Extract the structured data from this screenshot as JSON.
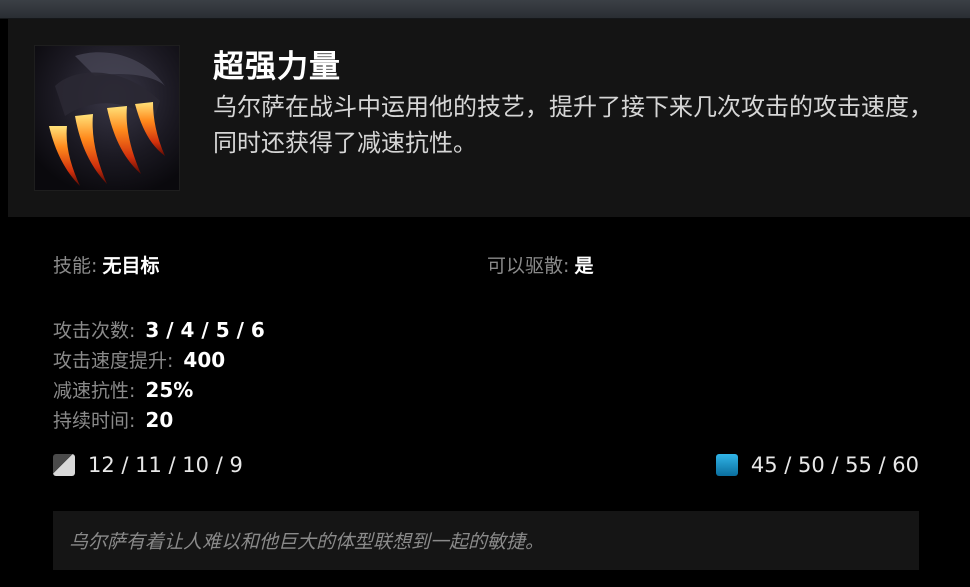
{
  "ability": {
    "icon": "claws-flame-icon",
    "title": "超强力量",
    "description": "乌尔萨在战斗中运用他的技艺，提升了接下来几次攻击的攻击速度，同时还获得了减速抗性。"
  },
  "info": {
    "ability_label": "技能:",
    "ability_value": "无目标",
    "dispellable_label": "可以驱散:",
    "dispellable_value": "是"
  },
  "stats": [
    {
      "label": "攻击次数:",
      "value": "3 / 4 / 5 / 6"
    },
    {
      "label": "攻击速度提升:",
      "value": "400"
    },
    {
      "label": "减速抗性:",
      "value": "25%"
    },
    {
      "label": "持续时间:",
      "value": "20"
    }
  ],
  "cooldown": {
    "icon": "cooldown-icon",
    "value": "12 / 11 / 10 / 9"
  },
  "manacost": {
    "icon": "mana-icon",
    "value": "45 / 50 / 55 / 60",
    "color": "#1a9fd6"
  },
  "lore": "乌尔萨有着让人难以和他巨大的体型联想到一起的敏捷。"
}
